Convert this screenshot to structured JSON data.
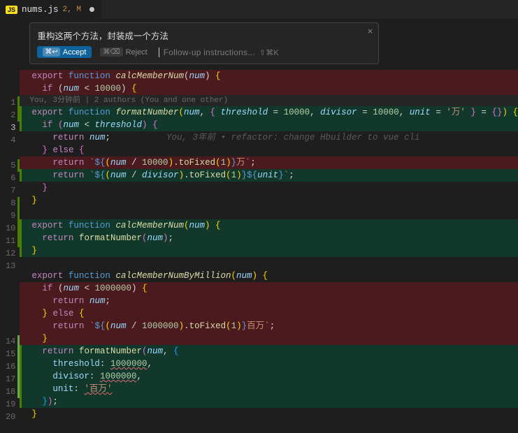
{
  "tab": {
    "icon_label": "JS",
    "filename": "nums.js",
    "badge": "2, M"
  },
  "float": {
    "title": "重构这两个方法，封装成一个方法",
    "accept_kb": "⌘↩",
    "accept": "Accept",
    "reject_kb": "⌘⌫",
    "reject": "Reject",
    "followup_placeholder": "Follow-up instructions...",
    "followup_kb": "⇧⌘K"
  },
  "blame_top": "You, 3分钟前 | 2 authors (You and one other)",
  "blame_inline": "You, 3年前 • refactor: change Hbuilder to vue cli",
  "lines": {
    "d1": {
      "kw_exp": "export",
      "kw_fn": "function",
      "name": "calcMemberNum",
      "param": "num"
    },
    "d2": {
      "kw_if": "if",
      "var": "num",
      "op": "<",
      "num": "10000"
    },
    "a1": {
      "kw_exp": "export",
      "kw_fn": "function",
      "name": "formatNumber",
      "p1": "num",
      "p2": "threshold",
      "v2": "10000",
      "p3": "divisor",
      "v3": "10000",
      "p4": "unit",
      "v4": "'万'"
    },
    "a2": {
      "kw_if": "if",
      "var": "num",
      "op": "<",
      "var2": "threshold"
    },
    "l3": {
      "kw_ret": "return",
      "var": "num"
    },
    "l4": {
      "kw_else": "else"
    },
    "d5": {
      "kw_ret": "return",
      "var": "num",
      "div": "10000",
      "fn": "toFixed",
      "arg": "1",
      "suffix": "万"
    },
    "a5": {
      "kw_ret": "return",
      "var": "num",
      "div": "divisor",
      "fn": "toFixed",
      "arg": "1",
      "unit": "unit"
    },
    "cm": {
      "kw_exp": "export",
      "kw_fn": "function",
      "name": "calcMemberNum",
      "param": "num",
      "kw_ret": "return",
      "call": "formatNumber",
      "arg": "num"
    },
    "mi": {
      "kw_exp": "export",
      "kw_fn": "function",
      "name": "calcMemberNumByMillion",
      "param": "num",
      "if_kw": "if",
      "if_var": "num",
      "if_num": "1000000",
      "ret": "return",
      "ret_var": "num",
      "else_kw": "else",
      "ret2": "return",
      "div_var": "num",
      "div_num": "1000000",
      "fx": "toFixed",
      "fx_arg": "1",
      "suffix": "百万",
      "call": "formatNumber",
      "arg_n": "num",
      "k1": "threshold",
      "v1": "1000000",
      "k2": "divisor",
      "v2": "1000000",
      "k3": "unit",
      "v3": "'百万'"
    }
  },
  "gutter_numbers": [
    "1",
    "2",
    "3",
    "4",
    "",
    "5",
    "6",
    "7",
    "8",
    "9",
    "10",
    "11",
    "12",
    "13",
    "",
    "",
    "",
    "",
    "",
    "14",
    "15",
    "16",
    "17",
    "18",
    "19",
    "20"
  ]
}
